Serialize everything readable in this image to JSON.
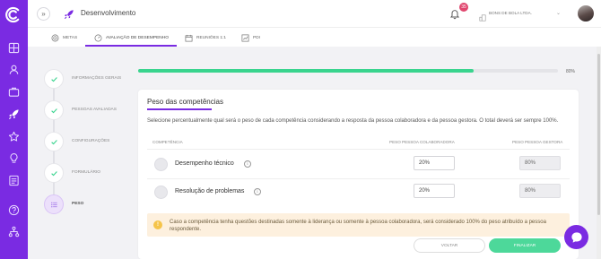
{
  "app": {
    "page_title": "Desenvolvimento",
    "notification_count": "35",
    "company_name": "BONS DE BOLA LTDA.",
    "accent_color": "#7a2be2",
    "success_color": "#39d48e"
  },
  "sidebar": {
    "icons": [
      "logo-icon",
      "dashboard-icon",
      "user-icon",
      "briefcase-icon",
      "rocket-icon",
      "star-icon",
      "lightbulb-icon",
      "document-icon",
      "help-icon",
      "org-chart-icon"
    ]
  },
  "tabs": [
    {
      "label": "METAS",
      "icon": "target-icon"
    },
    {
      "label": "AVALIAÇÃO DE DESEMPENHO",
      "icon": "gauge-icon",
      "active": true
    },
    {
      "label": "REUNIÕES 1:1",
      "icon": "calendar-icon"
    },
    {
      "label": "PDI",
      "icon": "chart-icon"
    }
  ],
  "steps": [
    {
      "label": "INFORMAÇÕES GERAIS",
      "done": true
    },
    {
      "label": "PESSOAS AVALIADAS",
      "done": true
    },
    {
      "label": "CONFIGURAÇÕES",
      "done": true
    },
    {
      "label": "FORMULÁRIO",
      "done": true
    },
    {
      "label": "PESO",
      "done": false,
      "current": true
    }
  ],
  "progress": {
    "value": 0.8,
    "label": "80%"
  },
  "card": {
    "title": "Peso das competências",
    "description": "Selecione percentualmente qual será o peso de cada competência considerando a resposta da pessoa colaboradora e da pessoa gestora. O total deverá ser sempre 100%.",
    "headers": {
      "competencia": "COMPETÊNCIA",
      "colaboradora": "PESO PESSOA COLABORADORA",
      "gestora": "PESO PESSOA GESTORA"
    },
    "rows": [
      {
        "name": "Desempenho técnico",
        "colaboradora": "20%",
        "gestora": "80%"
      },
      {
        "name": "Resolução de problemas",
        "colaboradora": "20%",
        "gestora": "80%"
      }
    ],
    "warning": "Caso a competência tenha questões destinadas somente à liderança ou somente à pessoa colaboradora, será considerado 100% do peso atribuído a pessoa respondente.",
    "buttons": {
      "back": "VOLTAR",
      "finish": "FINALIZAR"
    }
  }
}
